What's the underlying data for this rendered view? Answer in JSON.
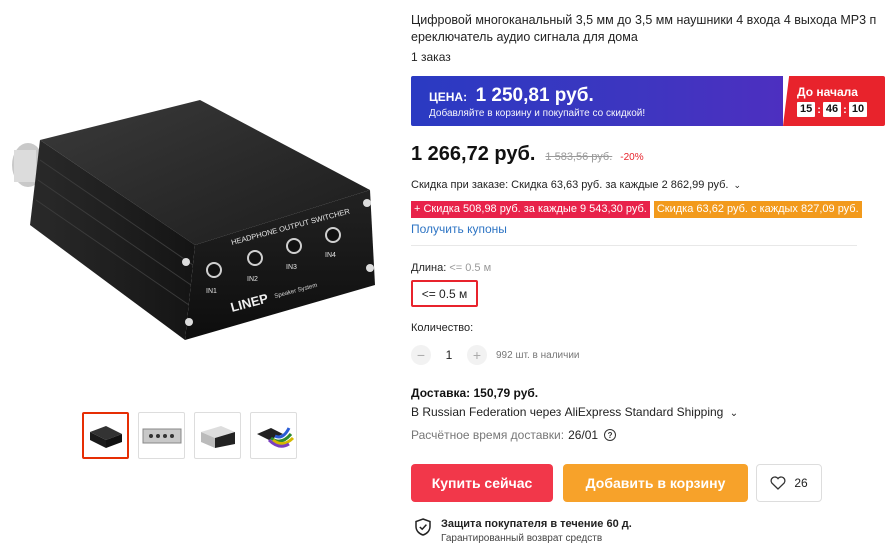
{
  "product": {
    "title": "Цифровой многоканальный 3,5 мм до 3,5 мм наушники 4 входа 4 выхода MP3 переключатель аудио сигнала для дома",
    "orders": "1 заказ"
  },
  "image": {
    "panel_text": "HEADPHONE OUTPUT SWITCHER",
    "jacks": [
      "IN1",
      "IN2",
      "IN3",
      "IN4"
    ],
    "brand": "LINEP",
    "brand_sub": "Speaker System"
  },
  "promo": {
    "label": "ЦЕНА:",
    "price": "1 250,81 руб.",
    "subtitle": "Добавляйте в корзину и покупайте со скидкой!",
    "countdown_label": "До начала",
    "timer": [
      "15",
      "46",
      "10"
    ],
    "timer_sep": ":"
  },
  "price": {
    "current": "1 266,72 руб.",
    "old": "1 583,56 руб.",
    "discount": "-20%"
  },
  "discounts": {
    "order_discount": "Скидка при заказе: Скидка 63,63 руб. за каждые 2 862,99 руб.",
    "tag_red": "Скидка 508,98 руб. за каждые 9 543,30 руб.",
    "tag_orange": "Скидка 63,62 руб. с каждых 827,09 руб.",
    "coupons_link": "Получить купоны"
  },
  "variant": {
    "label": "Длина:",
    "selected": "<= 0.5 м",
    "option": "<= 0.5 м"
  },
  "quantity": {
    "label": "Количество:",
    "value": "1",
    "minus": "−",
    "plus": "+",
    "stock": "992 шт. в наличии"
  },
  "shipping": {
    "title": "Доставка: 150,79 руб.",
    "via": "В Russian Federation через AliExpress Standard Shipping",
    "time_label": "Расчётное время доставки:",
    "time_value": "26/01"
  },
  "actions": {
    "buy": "Купить сейчас",
    "cart": "Добавить в корзину",
    "wishlist_count": "26"
  },
  "protection": {
    "title": "Защита покупателя в течение 60 д.",
    "subtitle": "Гарантированный возврат средств"
  },
  "colors": {
    "accent_red": "#e8232c",
    "promo_blue": "#2a3ac2",
    "buy_button": "#f2374a",
    "cart_button": "#f7a22a",
    "link_blue": "#2d74c4"
  }
}
